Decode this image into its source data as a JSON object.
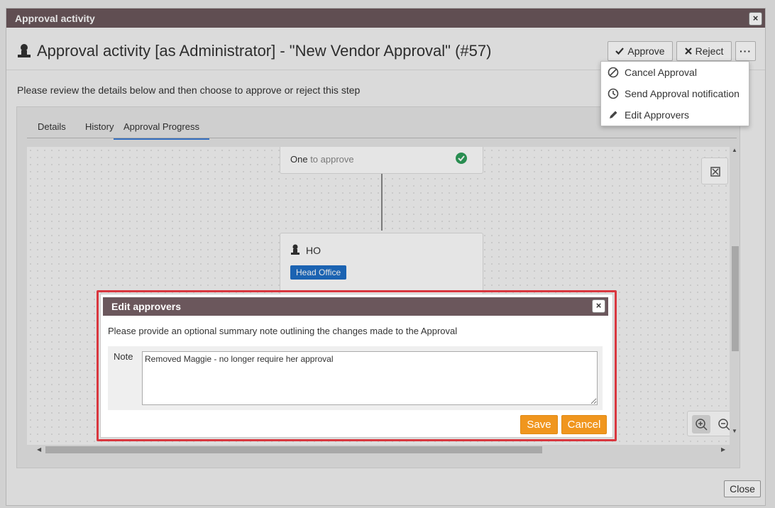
{
  "window": {
    "title": "Approval activity",
    "close_label": "×"
  },
  "header": {
    "title": "Approval activity [as Administrator] - \"New Vendor Approval\" (#57)",
    "title_icon": "person-icon",
    "approve_label": "Approve",
    "reject_label": "Reject",
    "more_label": "···"
  },
  "dropdown": {
    "items": [
      {
        "label": "Cancel Approval",
        "icon": "cancel-icon"
      },
      {
        "label": "Send Approval notification",
        "icon": "clock-icon"
      },
      {
        "label": "Edit Approvers",
        "icon": "pencil-icon"
      }
    ]
  },
  "instructions": "Please review the details below and then choose to approve or reject this step",
  "tabs": [
    {
      "label": "Details"
    },
    {
      "label": "History"
    },
    {
      "label": "Approval Progress",
      "active": true
    }
  ],
  "flow": {
    "node1": {
      "strong": "One",
      "rest": " to approve",
      "status": "approved"
    },
    "node2": {
      "label": "HO",
      "badge": "Head Office"
    }
  },
  "footer": {
    "close_label": "Close"
  },
  "modal": {
    "title": "Edit approvers",
    "close_label": "×",
    "description": "Please provide an optional summary note outlining the changes made to the Approval",
    "note_label": "Note",
    "note_value": "Removed Maggie - no longer require her approval",
    "save_label": "Save",
    "cancel_label": "Cancel"
  },
  "colors": {
    "titlebar": "#6b575c",
    "accent_orange": "#f0961e",
    "badge_blue": "#1f6fc7",
    "highlight_red": "#d9373f",
    "success_green": "#2e9e5b"
  }
}
